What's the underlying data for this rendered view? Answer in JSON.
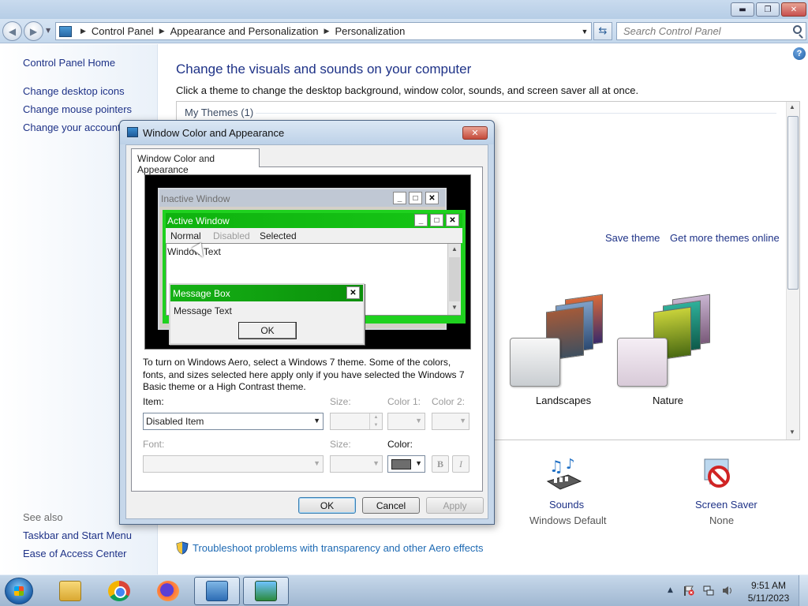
{
  "address": {
    "crumbs": [
      "Control Panel",
      "Appearance and Personalization",
      "Personalization"
    ],
    "search_placeholder": "Search Control Panel"
  },
  "left_pane": {
    "links": [
      "Control Panel Home",
      "Change desktop icons",
      "Change mouse pointers",
      "Change your account picture"
    ],
    "see_also_label": "See also",
    "see_also": [
      "Taskbar and Start Menu",
      "Ease of Access Center"
    ]
  },
  "main": {
    "heading": "Change the visuals and sounds on your computer",
    "description": "Click a theme to change the desktop background, window color, sounds, and screen saver all at once.",
    "my_themes": "My Themes (1)",
    "save_theme": "Save theme",
    "more_themes": "Get more themes online",
    "themes": [
      {
        "name": "Landscapes"
      },
      {
        "name": "Nature"
      }
    ],
    "bottom": {
      "sounds_label": "Sounds",
      "sounds_value": "Windows Default",
      "screensaver_label": "Screen Saver",
      "screensaver_value": "None"
    },
    "troubleshoot_link": "Troubleshoot problems with transparency and other Aero effects"
  },
  "dialog": {
    "title": "Window Color and Appearance",
    "tab": "Window Color and Appearance",
    "preview": {
      "inactive_title": "Inactive Window",
      "active_title": "Active Window",
      "menu": [
        "Normal",
        "Disabled",
        "Selected"
      ],
      "window_text": "Window Text",
      "msgbox_title": "Message Box",
      "msgbox_text": "Message Text",
      "msgbox_ok": "OK"
    },
    "info": "To turn on Windows Aero, select a Windows 7 theme.  Some of the colors, fonts, and sizes selected here apply only if you have selected the Windows 7 Basic theme or a High Contrast theme.",
    "item_label": "Item:",
    "item_value": "Disabled Item",
    "size_label": "Size:",
    "color1_label": "Color 1:",
    "color2_label": "Color 2:",
    "font_label": "Font:",
    "font_size_label": "Size:",
    "color_label": "Color:",
    "bold_label": "B",
    "italic_label": "I",
    "current_color": "#6d6d6d",
    "buttons": {
      "ok": "OK",
      "cancel": "Cancel",
      "apply": "Apply"
    }
  },
  "taskbar": {
    "clock_time": "9:51 AM",
    "clock_date": "5/11/2023"
  }
}
